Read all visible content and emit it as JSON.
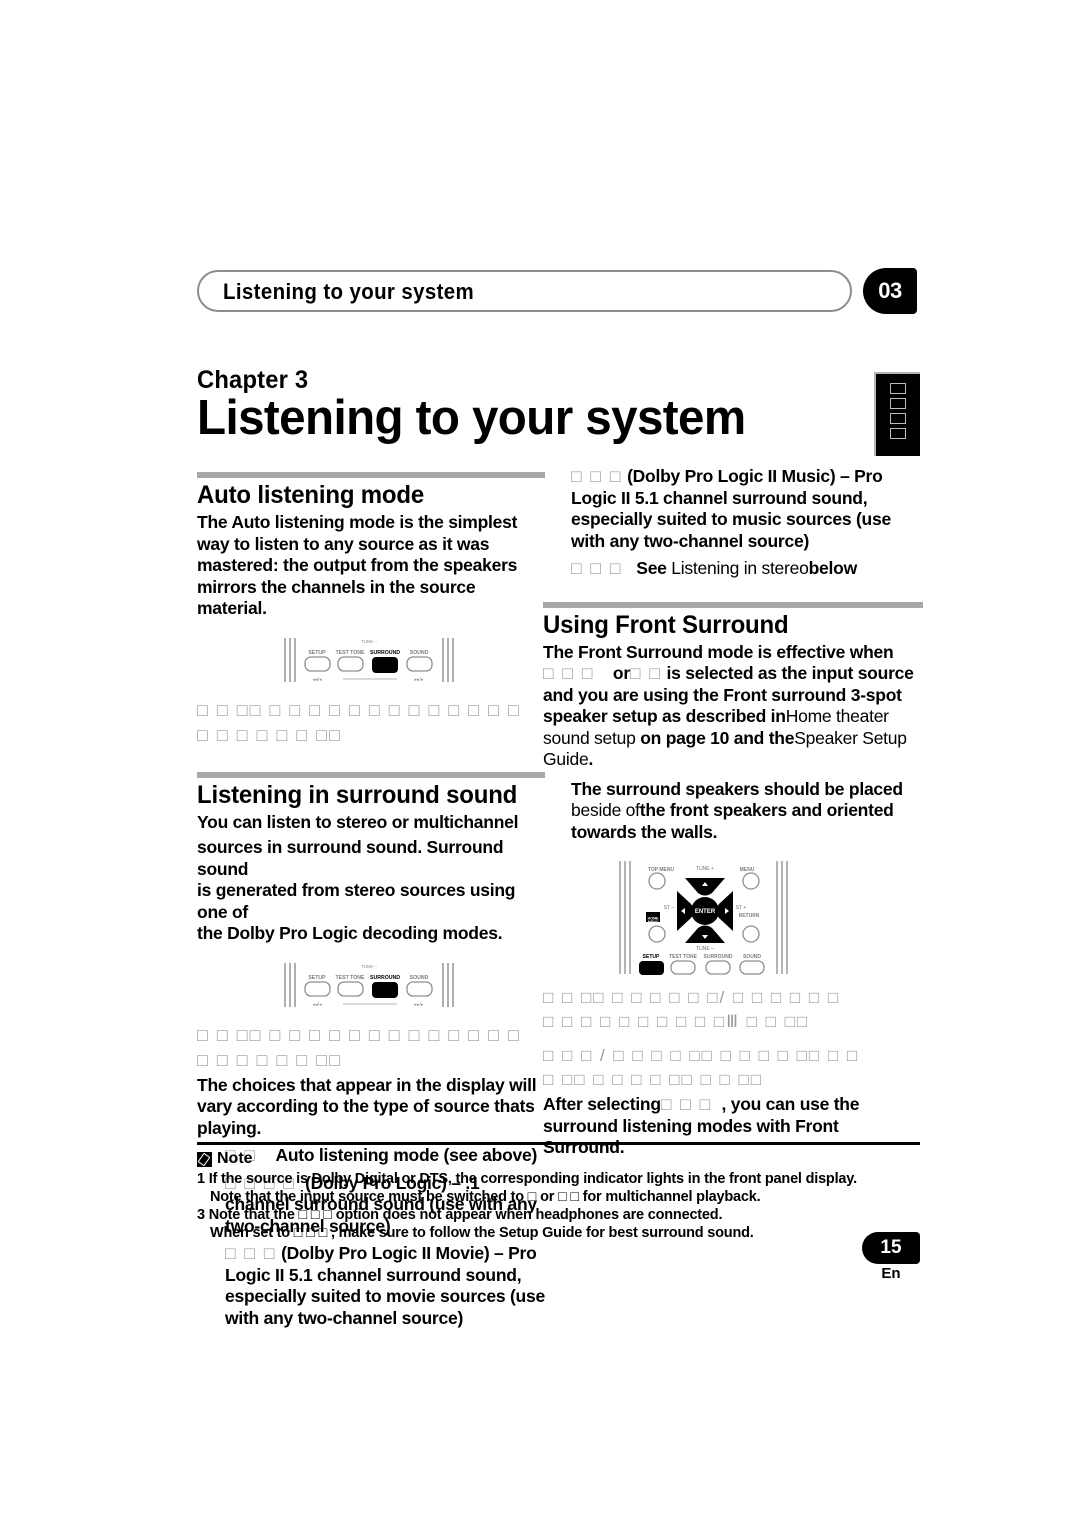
{
  "running_header": {
    "title": "Listening to your system",
    "chapter_number": "03"
  },
  "chapter": {
    "label": "Chapter 3",
    "title": "Listening to your system"
  },
  "thumb_tab": {
    "glyphs": [
      "□",
      "□",
      "□",
      "□"
    ]
  },
  "left_column": {
    "section1": {
      "heading": "Auto listening mode",
      "body": "The Auto listening mode is the simplest way to listen to any source as it was mastered: the output from the speakers mirrors the channels in the source material.",
      "figure_caption_line1": "□   □ □□ □ □ □    □ □ □ □ □ □ □ □ □ □",
      "figure_caption_line2": "□ □ □ □ □ □ □□"
    },
    "section2": {
      "heading": "Listening in surround sound",
      "body_line1": "You can listen to stereo or multichannel",
      "body_line2a": "sources in surround sound",
      "body_line2b": ". Surround sound",
      "body_line3": "is generated from stereo sources using one of",
      "body_line4": "the Dolby Pro Logic decoding modes.",
      "figure_caption_line1": "□   □ □□ □ □ □    □ □ □ □ □ □ □ □ □ □",
      "figure_caption_line2": "□ □ □ □ □ □ □□",
      "after_figure": "The choices that appear in the display will vary according to the type of source thats playing.",
      "items": [
        {
          "marker": "□ □",
          "text": "Auto listening mode (see above)"
        },
        {
          "marker": "□ □ □ □",
          "text": "(Dolby Pro Logic) – .1 channel surround sound (use with any two-channel source)"
        },
        {
          "marker": "□ □ □",
          "text": "(Dolby Pro Logic II Movie) – Pro Logic II 5.1 channel surround sound, especially suited to movie sources (use with any two-channel source)"
        }
      ]
    }
  },
  "right_column": {
    "continued_items": [
      {
        "marker": "□ □ □",
        "text": "(Dolby Pro Logic II Music) – Pro Logic II 5.1 channel surround sound, especially suited to music sources (use with any two-channel source)"
      },
      {
        "marker": "□ □ □",
        "bold_lead": "See",
        "reg_text": "Listening in stereo",
        "bold_tail": "below"
      }
    ],
    "section3": {
      "heading": "Using Front Surround",
      "line1": "The Front Surround mode is effective when",
      "line2_tofu_a": "□ □ □",
      "line2_or": "or",
      "line2_tofu_b": "□ □",
      "line2_tail": "is selected as the input source",
      "line3": "and you are using the Front surround 3-spot",
      "line4a": "speaker setup as described in",
      "line4b": "Home theater",
      "line5a": "sound setup",
      "line5b": "on page 10 and the",
      "line5c": "Speaker Setup",
      "line6a": "Guide",
      "line6b": ".",
      "callout_line1": "The surround speakers should be placed",
      "callout_line2a": "beside of",
      "callout_line2b": "the front speakers and oriented",
      "callout_line3": "towards the walls.",
      "figure_caption_line1": "□   □ □□ □ □ □ □ □ □/    □ □ □ □ □ □",
      "figure_caption_line2": "□ □ □ □ □ □ □ □ □ □Ⅲ □ □ □□",
      "figure_caption_line3": "□   □ □ /   □ □ □ □ □□ □ □ □   □ □□ □ □",
      "figure_caption_line4": "□ □□ □ □ □ □ □□ □ □ □□",
      "closing_a": "After selecting",
      "closing_tofu": "□ □ □",
      "closing_b": ", you can use the surround listening modes with Front Surround."
    }
  },
  "remote_figure": {
    "buttons_row": [
      "SETUP",
      "TEST TONE",
      "SURROUND",
      "SOUND"
    ],
    "top_label": "TUNE +",
    "bottom_label": "TUNE –",
    "left_label": "ST –",
    "right_label": "ST +",
    "center_label": "ENTER",
    "top_menu_label": "TOP MENU",
    "menu_label": "MENU",
    "home_menu_label": "HOME MENU",
    "return_label": "RETURN",
    "left_small": "◂◂/◂",
    "right_small": "▸▸/▸"
  },
  "note": {
    "title": "Note",
    "lines": [
      {
        "indent": false,
        "text": "1 If the source is Dolby Digital or DTS, the corresponding indicator lights in the front panel display."
      },
      {
        "indent": true,
        "text": "Note that the input source must be switched to □  or □ □  for multichannel playback."
      },
      {
        "indent": false,
        "text": "3 Note that the □ □ □  option does not appear when headphones are connected."
      },
      {
        "indent": true,
        "text": "When set to □ □ □ , make sure to follow the Setup Guide for best surround sound."
      }
    ]
  },
  "footer": {
    "page_number": "15",
    "language": "En"
  },
  "colors": {
    "rule_gray": "#a8a8a8",
    "tofu_gray": "#9a9a9a",
    "ink": "#000000",
    "paper": "#ffffff"
  }
}
